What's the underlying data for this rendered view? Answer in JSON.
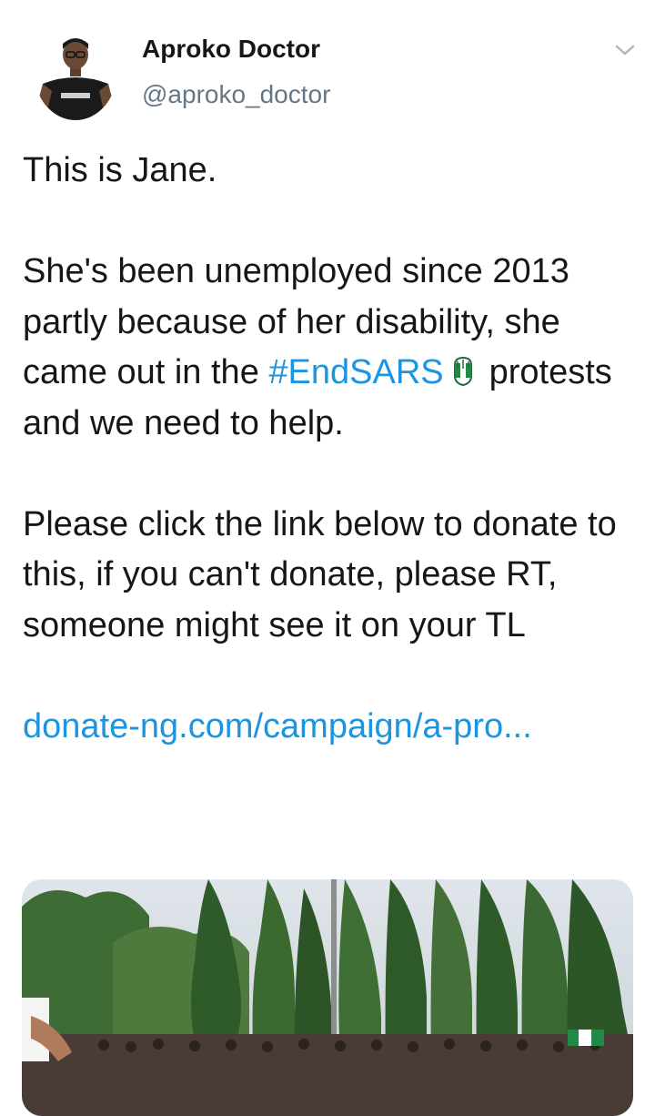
{
  "author": {
    "name": "Aproko Doctor",
    "handle": "@aproko_doctor",
    "avatar_icon": "profile-photo"
  },
  "menu": {
    "icon": "chevron-down-icon"
  },
  "tweet": {
    "line1": "This is Jane.",
    "para2_before": "She's been unemployed since 2013 partly because of her disability, she came out in the ",
    "hashtag": "#EndSARS",
    "hashtag_emoji": "raised-fist-nigeria-flag",
    "para2_after": "protests and we need to help.",
    "para3": "Please click the link below to donate to this, if you can't donate, please RT, someone might see it on your TL",
    "link": "donate-ng.com/campaign/a-pro..."
  },
  "media": {
    "description_icon": "protest-photo"
  },
  "colors": {
    "text": "#14171a",
    "secondary": "#657786",
    "link": "#1b95e0"
  }
}
